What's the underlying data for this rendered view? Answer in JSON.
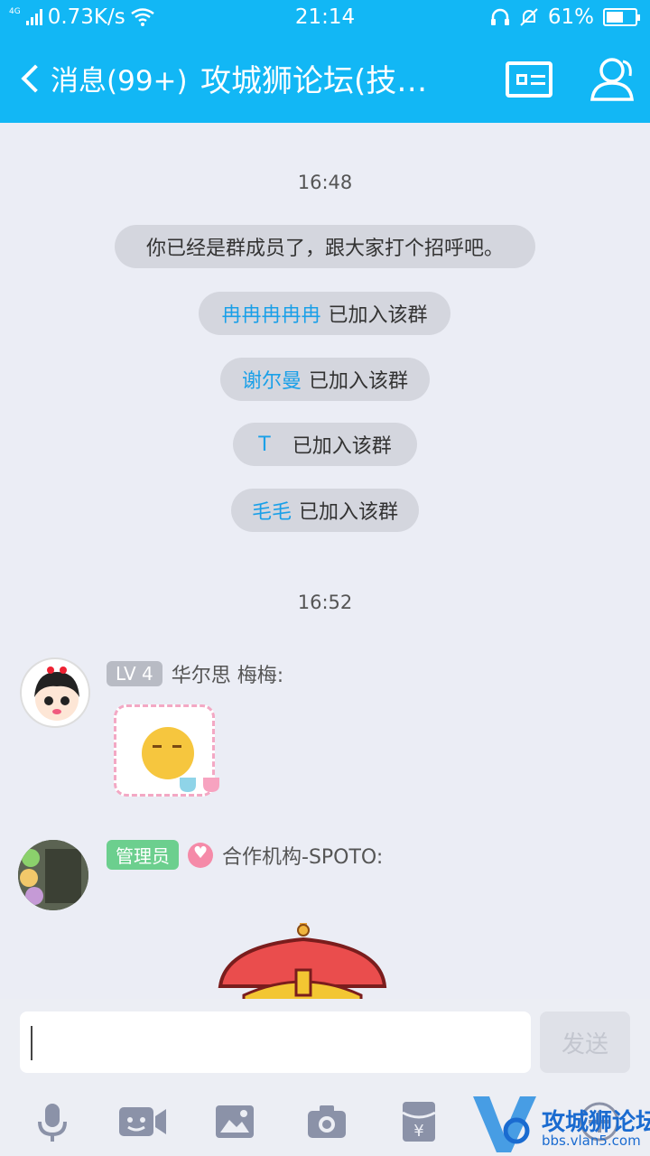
{
  "status_bar": {
    "network": "4G",
    "speed": "0.73K/s",
    "time": "21:14",
    "battery": "61%",
    "battery_level": 0.61
  },
  "header": {
    "back_label": "消息(99+)",
    "title": "攻城狮论坛(技…"
  },
  "timestamps": [
    "16:48",
    "16:52"
  ],
  "system_messages": [
    {
      "highlight": "",
      "text": "你已经是群成员了，跟大家打个招呼吧。"
    },
    {
      "highlight": "冉冉冉冉冉",
      "text": "已加入该群"
    },
    {
      "highlight": "谢尔曼",
      "text": "已加入该群"
    },
    {
      "highlight": "T",
      "text": "已加入该群"
    },
    {
      "highlight": "毛毛",
      "text": "已加入该群"
    }
  ],
  "messages": [
    {
      "badge": "LV 4",
      "badge_color": "#b8bbc4",
      "sender": "华尔思 梅梅:"
    },
    {
      "badge": "管理员",
      "badge_color": "#6ccf8e",
      "sender": "合作机构-SPOTO:"
    }
  ],
  "composer": {
    "send_label": "发送"
  },
  "toolbar": [
    "microphone-icon",
    "video-icon",
    "image-icon",
    "camera-icon",
    "red-packet-icon",
    "plus-icon"
  ],
  "watermark": {
    "title": "攻城狮论坛",
    "url": "bbs.vlan5.com"
  },
  "colors": {
    "header": "#12b7f5",
    "highlight": "#1aa0e8",
    "background": "#ebedf5"
  }
}
